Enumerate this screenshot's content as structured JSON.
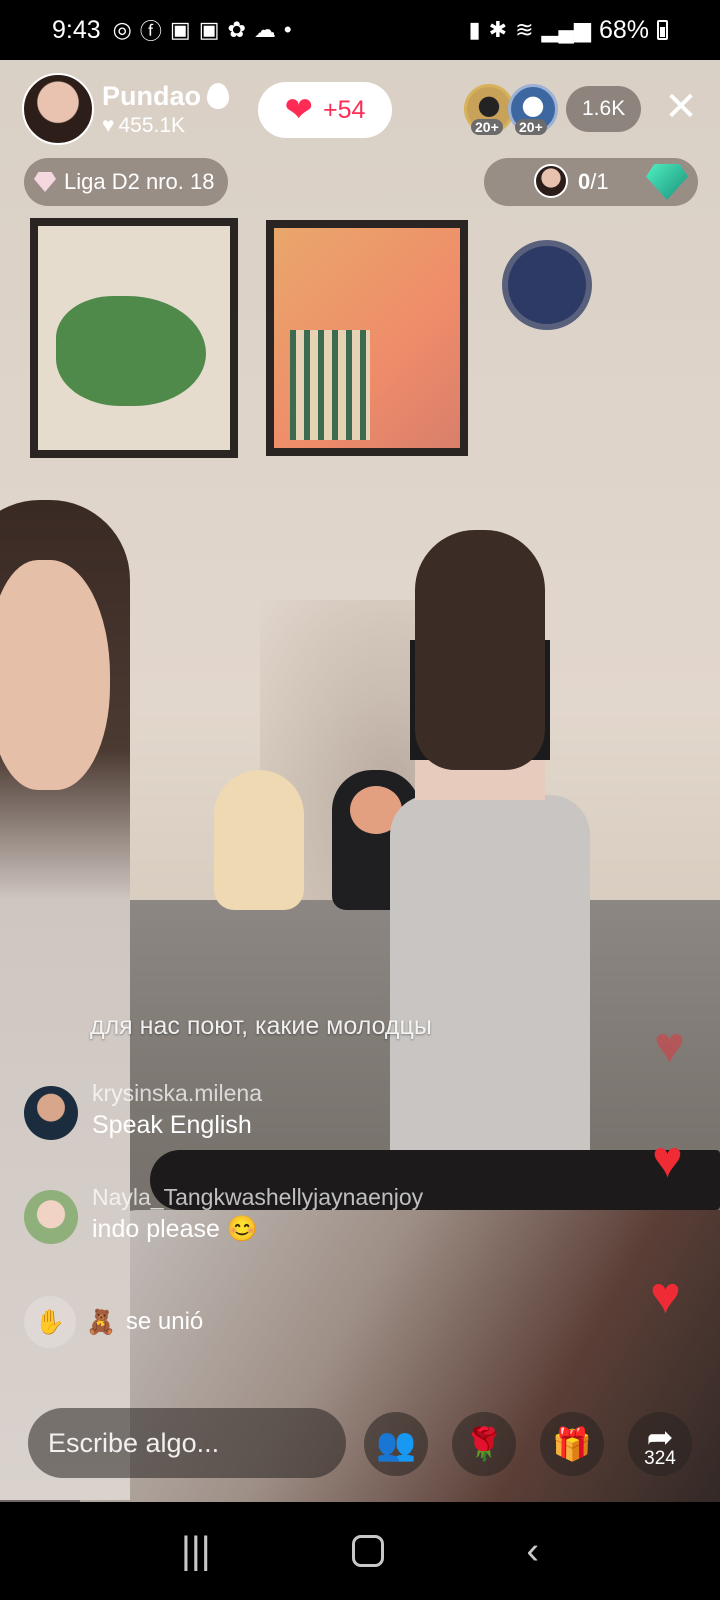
{
  "status_bar": {
    "time": "9:43",
    "left_icons": [
      "whatsapp-icon",
      "facebook-icon",
      "instagram-icon",
      "instagram-icon",
      "flower-icon",
      "weather-icon",
      "dot-icon"
    ],
    "battery": "68%"
  },
  "host": {
    "name": "Pundao",
    "likes": "455.1K"
  },
  "like_button": {
    "count": "+54"
  },
  "viewers": {
    "badge_1": "20+",
    "badge_2": "20+",
    "count": "1.6K"
  },
  "league": {
    "label": "Liga D2 nro. 18"
  },
  "goal": {
    "current": "0",
    "total": "/1"
  },
  "chat": {
    "message_1": "для нас поют, какие молодцы",
    "items": [
      {
        "user": "krysinska.milena",
        "text": "Speak English"
      },
      {
        "user": "Nayla_Tangkwashellyjaynaenjoy",
        "text": "indo please 😊"
      }
    ],
    "join": {
      "emoji": "🧸",
      "text": "se unió"
    }
  },
  "bottom_bar": {
    "comment_placeholder": "Escribe algo...",
    "share_count": "324"
  },
  "colors": {
    "accent": "#fe2c55",
    "heart": "#ef2b35"
  }
}
